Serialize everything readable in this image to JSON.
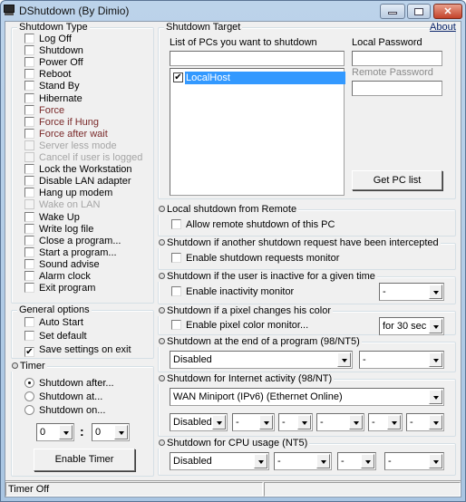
{
  "window": {
    "title": "DShutdown (By Dimio)",
    "icon": "computer-icon",
    "controls": [
      "minimize",
      "maximize",
      "close"
    ]
  },
  "shutdown_type": {
    "label": "Shutdown Type",
    "items": [
      {
        "label": "Log Off",
        "checked": false,
        "style": "normal"
      },
      {
        "label": "Shutdown",
        "checked": false,
        "style": "normal"
      },
      {
        "label": "Power Off",
        "checked": false,
        "style": "normal"
      },
      {
        "label": "Reboot",
        "checked": false,
        "style": "normal"
      },
      {
        "label": "Stand By",
        "checked": false,
        "style": "normal"
      },
      {
        "label": "Hibernate",
        "checked": false,
        "style": "normal"
      },
      {
        "label": "Force",
        "checked": false,
        "style": "red"
      },
      {
        "label": "Force if Hung",
        "checked": false,
        "style": "red"
      },
      {
        "label": "Force after wait",
        "checked": false,
        "style": "red"
      },
      {
        "label": "Server less mode",
        "checked": false,
        "style": "disabled"
      },
      {
        "label": "Cancel if user is logged",
        "checked": false,
        "style": "disabled"
      },
      {
        "label": "Lock the Workstation",
        "checked": false,
        "style": "normal"
      },
      {
        "label": "Disable LAN adapter",
        "checked": false,
        "style": "normal"
      },
      {
        "label": "Hang up modem",
        "checked": false,
        "style": "normal"
      },
      {
        "label": "Wake on LAN",
        "checked": false,
        "style": "disabled"
      },
      {
        "label": "Wake Up",
        "checked": false,
        "style": "normal"
      },
      {
        "label": "Write log file",
        "checked": false,
        "style": "normal"
      },
      {
        "label": "Close a program...",
        "checked": false,
        "style": "normal"
      },
      {
        "label": "Start a program...",
        "checked": false,
        "style": "normal"
      },
      {
        "label": "Sound advise",
        "checked": false,
        "style": "normal"
      },
      {
        "label": "Alarm clock",
        "checked": false,
        "style": "normal"
      },
      {
        "label": "Exit program",
        "checked": false,
        "style": "normal"
      }
    ]
  },
  "general_options": {
    "label": "General options",
    "items": [
      {
        "label": "Auto Start",
        "checked": false
      },
      {
        "label": "Set default",
        "checked": false
      },
      {
        "label": "Save settings on exit",
        "checked": true
      }
    ]
  },
  "timer": {
    "label": "Timer",
    "radios": [
      {
        "label": "Shutdown after...",
        "selected": true
      },
      {
        "label": "Shutdown at...",
        "selected": false
      },
      {
        "label": "Shutdown on...",
        "selected": false
      }
    ],
    "hours_value": "0",
    "separator": ":",
    "minutes_value": "0",
    "enable_button": "Enable Timer"
  },
  "shutdown_target": {
    "label": "Shutdown Target",
    "about_link": "About",
    "pc_list_label": "List of PCs you want to shutdown",
    "pc_input_value": "",
    "pcs": [
      {
        "label": "LocalHost",
        "checked": true,
        "selected": true
      }
    ],
    "local_password_label": "Local Password",
    "local_password_value": "",
    "remote_password_label": "Remote Password",
    "remote_password_value": "",
    "get_pc_list_button": "Get PC list"
  },
  "local_remote": {
    "label": "Local shutdown from Remote",
    "checkbox": {
      "label": "Allow remote shutdown of this PC",
      "checked": false
    }
  },
  "intercept": {
    "label": "Shutdown if another shutdown request have been intercepted",
    "checkbox": {
      "label": "Enable shutdown requests monitor",
      "checked": false
    }
  },
  "inactive": {
    "label": "Shutdown if the user is inactive for a given time",
    "checkbox": {
      "label": "Enable inactivity monitor",
      "checked": false
    },
    "combo_value": "-"
  },
  "pixel": {
    "label": "Shutdown if a pixel changes his color",
    "checkbox": {
      "label": "Enable pixel color monitor...",
      "checked": false
    },
    "combo_value": "for 30 sec"
  },
  "end_program": {
    "label": "Shutdown at the end of a program (98/NT5)",
    "combo1_value": "Disabled",
    "combo2_value": "-"
  },
  "internet": {
    "label": "Shutdown for Internet activity (98/NT)",
    "adapter_value": "WAN Miniport (IPv6) (Ethernet Online)",
    "combos": [
      "Disabled",
      "-",
      "-",
      "-",
      "-",
      "-"
    ]
  },
  "cpu": {
    "label": "Shutdown for CPU usage (NT5)",
    "combos": [
      "Disabled",
      "-",
      "-",
      "-"
    ]
  },
  "status_bar": {
    "pane1": "Timer Off",
    "pane2": ""
  }
}
